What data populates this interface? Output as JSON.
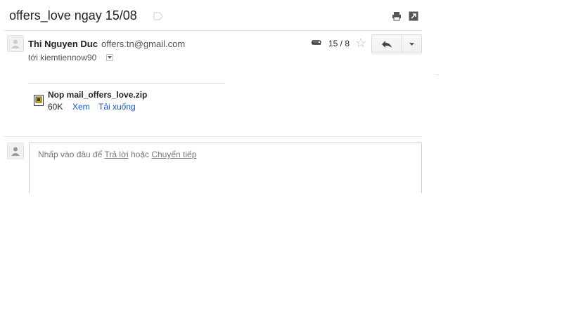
{
  "subject": "offers_love ngay 15/08",
  "message": {
    "sender_name": "Thi Nguyen Duc",
    "sender_email": "offers.tn@gmail.com",
    "to_line": "tới kiemtiennow90",
    "date": "15 / 8"
  },
  "attachment": {
    "filename": "Nop mail_offers_love.zip",
    "size": "60K",
    "view_label": "Xem",
    "download_label": "Tải xuống"
  },
  "reply_box": {
    "prompt_start": "Nhấp vào đâu để",
    "reply_link": "Trả lời",
    "or_text": "hoặc",
    "forward_link": "Chuyển tiếp"
  },
  "colors": {
    "link": "#1155cc",
    "text": "#222222",
    "muted": "#777777"
  }
}
